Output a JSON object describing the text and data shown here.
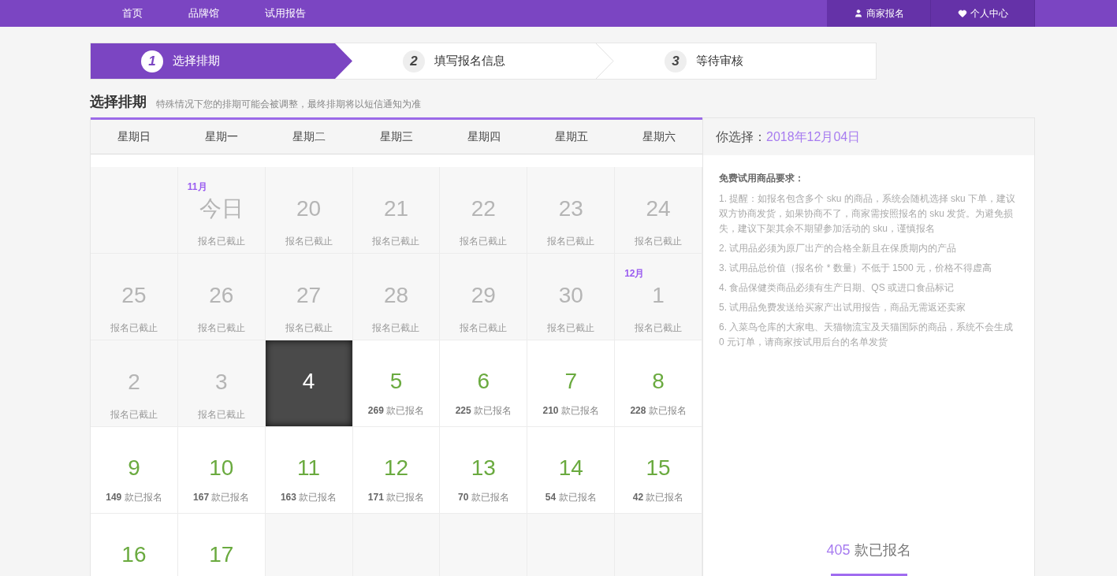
{
  "nav": {
    "items": [
      {
        "label": "首页"
      },
      {
        "label": "品牌馆"
      },
      {
        "label": "试用报告"
      }
    ],
    "right_items": [
      {
        "label": "商家报名"
      },
      {
        "label": "个人中心"
      }
    ]
  },
  "steps": [
    {
      "number": "1",
      "label": "选择排期",
      "selected": true
    },
    {
      "number": "2",
      "label": "填写报名信息",
      "selected": false
    },
    {
      "number": "3",
      "label": "等待审核",
      "selected": false
    }
  ],
  "section": {
    "title": "选择排期",
    "note": "特殊情况下您的排期可能会被调整，最终排期将以短信通知为准"
  },
  "calendar": {
    "weekdays": [
      "星期日",
      "星期一",
      "星期二",
      "星期三",
      "星期四",
      "星期五",
      "星期六"
    ],
    "cells": [
      {
        "kind": "empty"
      },
      {
        "kind": "closed",
        "month": "11月",
        "day": "今日",
        "note": "报名已截止"
      },
      {
        "kind": "closed",
        "day": "20",
        "note": "报名已截止"
      },
      {
        "kind": "closed",
        "day": "21",
        "note": "报名已截止"
      },
      {
        "kind": "closed",
        "day": "22",
        "note": "报名已截止"
      },
      {
        "kind": "closed",
        "day": "23",
        "note": "报名已截止"
      },
      {
        "kind": "closed",
        "day": "24",
        "note": "报名已截止"
      },
      {
        "kind": "closed",
        "day": "25",
        "note": "报名已截止"
      },
      {
        "kind": "closed",
        "day": "26",
        "note": "报名已截止"
      },
      {
        "kind": "closed",
        "day": "27",
        "note": "报名已截止"
      },
      {
        "kind": "closed",
        "day": "28",
        "note": "报名已截止"
      },
      {
        "kind": "closed",
        "day": "29",
        "note": "报名已截止"
      },
      {
        "kind": "closed",
        "day": "30",
        "note": "报名已截止"
      },
      {
        "kind": "closed",
        "month": "12月",
        "day": "1",
        "note": "报名已截止"
      },
      {
        "kind": "closed",
        "day": "2",
        "note": "报名已截止"
      },
      {
        "kind": "closed",
        "day": "3",
        "note": "报名已截止"
      },
      {
        "kind": "open",
        "day": "4",
        "selected": true
      },
      {
        "kind": "open",
        "day": "5",
        "count": "269",
        "count_label": "款已报名",
        "selected": false
      },
      {
        "kind": "open",
        "day": "6",
        "count": "225",
        "count_label": "款已报名",
        "selected": false
      },
      {
        "kind": "open",
        "day": "7",
        "count": "210",
        "count_label": "款已报名",
        "selected": false
      },
      {
        "kind": "open",
        "day": "8",
        "count": "228",
        "count_label": "款已报名",
        "selected": false
      },
      {
        "kind": "open",
        "day": "9",
        "count": "149",
        "count_label": "款已报名",
        "selected": false
      },
      {
        "kind": "open",
        "day": "10",
        "count": "167",
        "count_label": "款已报名",
        "selected": false
      },
      {
        "kind": "open",
        "day": "11",
        "count": "163",
        "count_label": "款已报名",
        "selected": false
      },
      {
        "kind": "open",
        "day": "12",
        "count": "171",
        "count_label": "款已报名",
        "selected": false
      },
      {
        "kind": "open",
        "day": "13",
        "count": "70",
        "count_label": "款已报名",
        "selected": false
      },
      {
        "kind": "open",
        "day": "14",
        "count": "54",
        "count_label": "款已报名",
        "selected": false
      },
      {
        "kind": "open",
        "day": "15",
        "count": "42",
        "count_label": "款已报名",
        "selected": false
      },
      {
        "kind": "open",
        "day": "16",
        "selected": false
      },
      {
        "kind": "open",
        "day": "17",
        "selected": false
      },
      {
        "kind": "empty"
      },
      {
        "kind": "empty"
      },
      {
        "kind": "empty"
      },
      {
        "kind": "empty"
      },
      {
        "kind": "empty"
      }
    ]
  },
  "panel": {
    "label": "你选择：",
    "date": "2018年12月04日",
    "requirements_title": "免费试用商品要求：",
    "requirements": [
      "1. 提醒：如报名包含多个 sku 的商品，系统会随机选择 sku 下单，建议双方协商发货，如果协商不了，商家需按照报名的 sku 发货。为避免损失，建议下架其余不期望参加活动的 sku，谨慎报名",
      "2. 试用品必须为原厂出产的合格全新且在保质期内的产品",
      "3. 试用品总价值（报名价 * 数量）不低于 1500 元，价格不得虚高",
      "4. 食品保健类商品必须有生产日期、QS 或进口食品标记",
      "5. 试用品免费发送给买家产出试用报告，商品无需返还卖家",
      "6. 入菜鸟仓库的大家电、天猫物流宝及天猫国际的商品，系统不会生成 0 元订单，请商家按试用后台的名单发货"
    ],
    "total": "405",
    "total_label": "款已报名"
  }
}
